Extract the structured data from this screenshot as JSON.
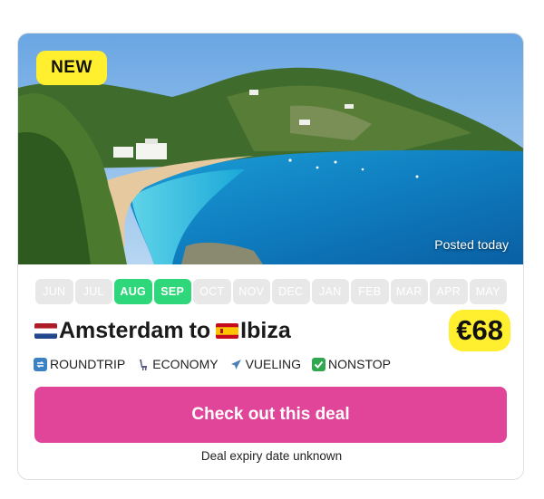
{
  "card": {
    "badge": "NEW",
    "posted": "Posted today",
    "image_alt": "Ibiza beach"
  },
  "months": [
    {
      "label": "JUN",
      "active": false
    },
    {
      "label": "JUL",
      "active": false
    },
    {
      "label": "AUG",
      "active": true
    },
    {
      "label": "SEP",
      "active": true
    },
    {
      "label": "OCT",
      "active": false
    },
    {
      "label": "NOV",
      "active": false
    },
    {
      "label": "DEC",
      "active": false
    },
    {
      "label": "JAN",
      "active": false
    },
    {
      "label": "FEB",
      "active": false
    },
    {
      "label": "MAR",
      "active": false
    },
    {
      "label": "APR",
      "active": false
    },
    {
      "label": "MAY",
      "active": false
    }
  ],
  "route": {
    "origin": "Amsterdam",
    "connector": "to",
    "destination": "Ibiza",
    "origin_flag": "netherlands-flag",
    "destination_flag": "spain-flag"
  },
  "price": "€68",
  "tags": [
    {
      "icon": "repeat-icon",
      "label": "ROUNDTRIP"
    },
    {
      "icon": "seat-icon",
      "label": "ECONOMY"
    },
    {
      "icon": "airplane-icon",
      "label": "VUELING"
    },
    {
      "icon": "check-icon",
      "label": "NONSTOP"
    }
  ],
  "cta_label": "Check out this deal",
  "expiry": "Deal expiry date unknown",
  "colors": {
    "badge": "#ffef2e",
    "month_active": "#2ed87a",
    "month_inactive": "#e8e8e8",
    "cta": "#e0459a"
  }
}
